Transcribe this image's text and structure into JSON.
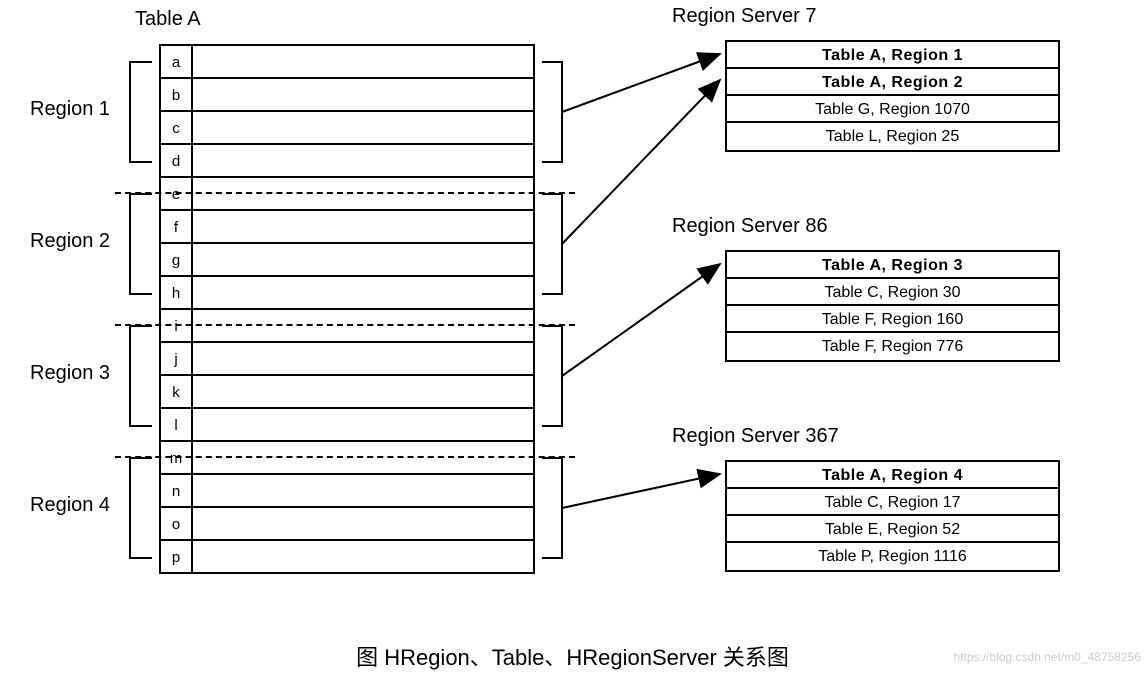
{
  "table_a": {
    "title": "Table A",
    "rows": [
      "a",
      "b",
      "c",
      "d",
      "e",
      "f",
      "g",
      "h",
      "i",
      "j",
      "k",
      "l",
      "m",
      "n",
      "o",
      "p"
    ]
  },
  "region_labels": [
    "Region 1",
    "Region 2",
    "Region 3",
    "Region 4"
  ],
  "servers": [
    {
      "title": "Region Server 7",
      "rows": [
        {
          "text": "Table A, Region 1",
          "bold": true
        },
        {
          "text": "Table A, Region 2",
          "bold": true
        },
        {
          "text": "Table G, Region 1070",
          "bold": false
        },
        {
          "text": "Table L, Region 25",
          "bold": false
        }
      ]
    },
    {
      "title": "Region Server 86",
      "rows": [
        {
          "text": "Table A, Region 3",
          "bold": true
        },
        {
          "text": "Table C, Region 30",
          "bold": false
        },
        {
          "text": "Table F, Region 160",
          "bold": false
        },
        {
          "text": "Table F, Region 776",
          "bold": false
        }
      ]
    },
    {
      "title": "Region Server 367",
      "rows": [
        {
          "text": "Table A, Region 4",
          "bold": true
        },
        {
          "text": "Table C, Region 17",
          "bold": false
        },
        {
          "text": "Table E, Region 52",
          "bold": false
        },
        {
          "text": "Table P, Region 1116",
          "bold": false
        }
      ]
    }
  ],
  "caption": "图 HRegion、Table、HRegionServer 关系图",
  "watermark": "https://blog.csdn.net/m0_48758256",
  "chart_data": {
    "type": "table",
    "description": "HBase Table A split into 4 regions, each region assigned to a Region Server that also hosts other table regions.",
    "table": "Table A",
    "row_keys": [
      "a",
      "b",
      "c",
      "d",
      "e",
      "f",
      "g",
      "h",
      "i",
      "j",
      "k",
      "l",
      "m",
      "n",
      "o",
      "p"
    ],
    "regions": [
      {
        "name": "Region 1",
        "row_keys": [
          "a",
          "b",
          "c",
          "d"
        ],
        "assigned_to": "Region Server 7"
      },
      {
        "name": "Region 2",
        "row_keys": [
          "e",
          "f",
          "g",
          "h"
        ],
        "assigned_to": "Region Server 7"
      },
      {
        "name": "Region 3",
        "row_keys": [
          "i",
          "j",
          "k",
          "l"
        ],
        "assigned_to": "Region Server 86"
      },
      {
        "name": "Region 4",
        "row_keys": [
          "m",
          "n",
          "o",
          "p"
        ],
        "assigned_to": "Region Server 367"
      }
    ],
    "region_servers": [
      {
        "name": "Region Server 7",
        "hosts": [
          "Table A, Region 1",
          "Table A, Region 2",
          "Table G, Region 1070",
          "Table L, Region 25"
        ]
      },
      {
        "name": "Region Server 86",
        "hosts": [
          "Table A, Region 3",
          "Table C, Region 30",
          "Table F, Region 160",
          "Table F, Region 776"
        ]
      },
      {
        "name": "Region Server 367",
        "hosts": [
          "Table A, Region 4",
          "Table C, Region 17",
          "Table E, Region 52",
          "Table P, Region 1116"
        ]
      }
    ]
  }
}
